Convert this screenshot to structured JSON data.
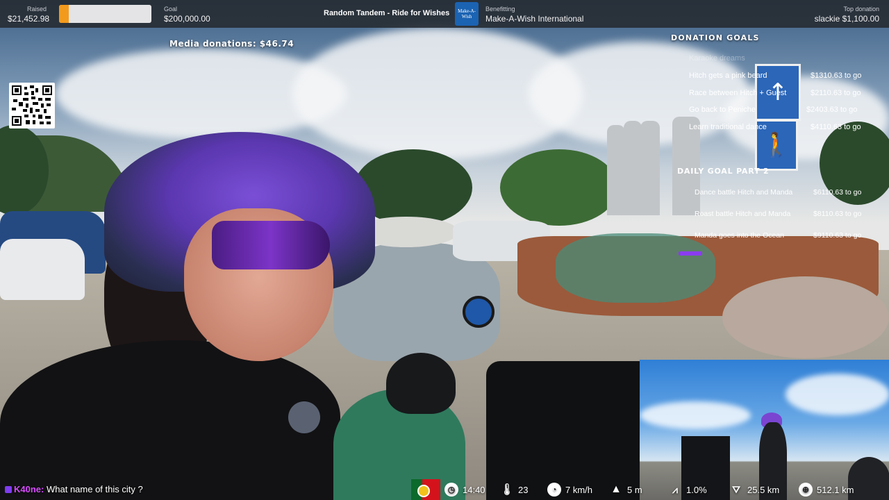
{
  "top_bar": {
    "raised_label": "Raised",
    "raised_value": "$21,452.98",
    "goal_label": "Goal",
    "goal_value": "$200,000.00",
    "progress_fraction": 0.107,
    "progress_color": "#f29a1c",
    "stream_title": "Random Tandem - Ride for Wishes",
    "charity_logo_text": "Make-A-Wish",
    "benefitting_label": "Benefitting",
    "benefitting_value": "Make-A-Wish International",
    "top_donation_label": "Top donation",
    "top_donation_value": "slackie $1,100.00"
  },
  "media_donations": "Media donations: $46.74",
  "qr_code": {
    "icon": "qr-code-icon"
  },
  "donation_goals": {
    "heading": "DONATION GOALS",
    "completed": "Karaoke dreams",
    "items": [
      {
        "name": "Hitch gets a pink beard",
        "amount": "$1310.63 to go"
      },
      {
        "name": "Race between Hitch + Guest",
        "amount": "$2110.63 to go"
      },
      {
        "name": "Go back to Peniche",
        "amount": "$2403.63 to go"
      },
      {
        "name": "Learn traditional dance",
        "amount": "$4110.63 to go"
      }
    ]
  },
  "daily_goals": {
    "heading": "DAILY GOAL PART 2",
    "items": [
      {
        "name": "Dance battle Hitch and Manda",
        "amount": "$6110.63 to go"
      },
      {
        "name": "Roast battle Hitch and Manda",
        "amount": "$8110.63 to go"
      },
      {
        "name": "Manda goes into the Ocean",
        "amount": "$9110.63 to go"
      }
    ],
    "accent_color": "#8a3cf0"
  },
  "chat": {
    "username": "K40ne:",
    "message": "What name of this city ?"
  },
  "stats": {
    "flag": "Portugal",
    "time": "14:40",
    "temperature": "23",
    "speed": "7 km/h",
    "altitude": "5 m",
    "grade": "1.0%",
    "distance_today": "25.5 km",
    "distance_total": "512.1 km",
    "icons": [
      "clock-icon",
      "thermometer-icon",
      "speedometer-icon",
      "mountain-icon",
      "incline-icon",
      "road-icon",
      "globe-icon"
    ]
  }
}
